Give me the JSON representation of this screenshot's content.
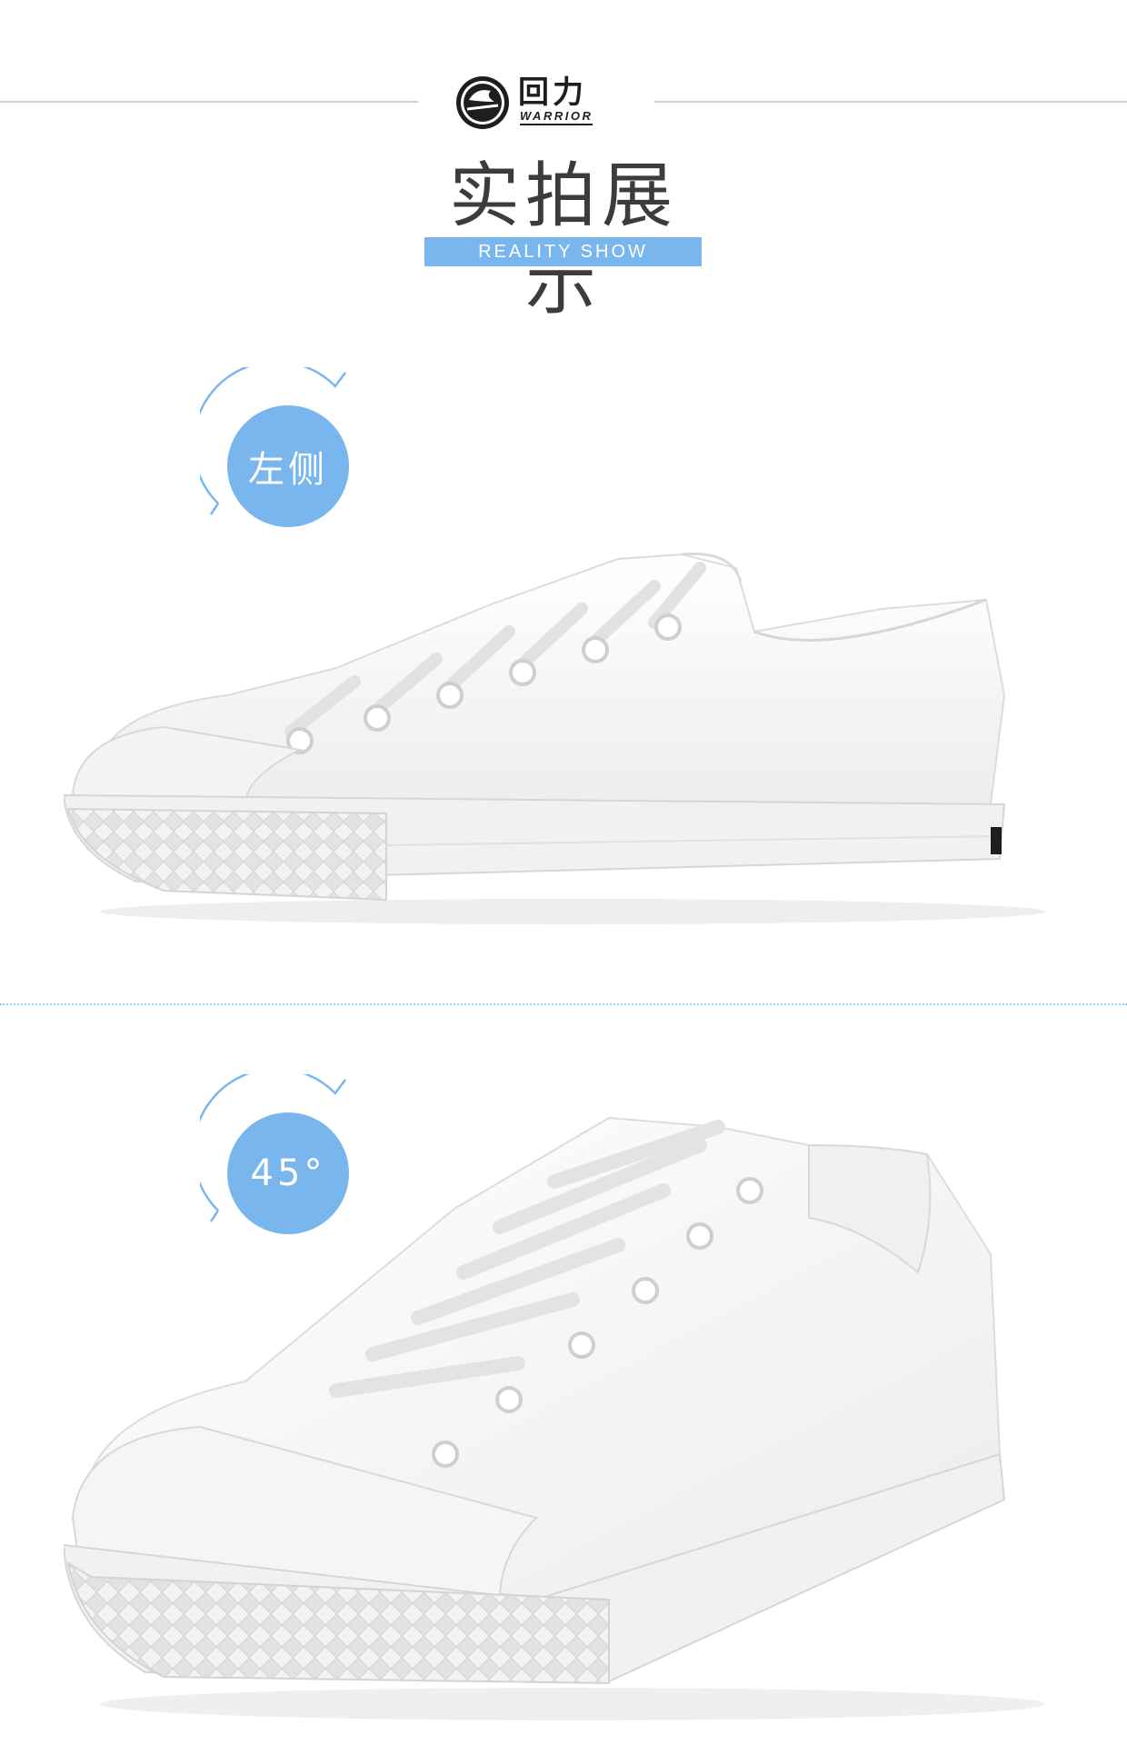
{
  "header": {
    "logo_cn": "回力",
    "logo_en": "WARRIOR",
    "emblem_text": "warrior",
    "title_cn": "实拍展示",
    "title_en": "REALITY SHOW"
  },
  "sections": [
    {
      "badge_label": "左侧",
      "view": "side"
    },
    {
      "badge_label": "45°",
      "view": "angle"
    }
  ],
  "colors": {
    "accent": "#7ab6ee",
    "divider": "#9cc8ef",
    "text": "#3c3c3c"
  }
}
